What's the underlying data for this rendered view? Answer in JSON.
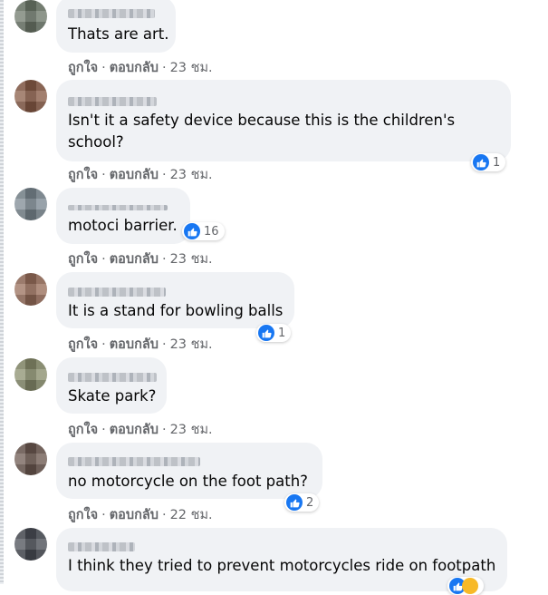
{
  "action_labels": {
    "like": "ถูกใจ",
    "reply": "ตอบกลับ",
    "separator": "·"
  },
  "comments": [
    {
      "text": "Thats are art.",
      "time": "23 ชม.",
      "reaction_count": null
    },
    {
      "text": "Isn't it a safety device because this is the children's\nschool?",
      "time": "23 ชม.",
      "reaction_count": "1"
    },
    {
      "text": "motoci barrier.",
      "time": "23 ชม.",
      "reaction_count": "16"
    },
    {
      "text": "It is a stand for bowling balls",
      "time": "23 ชม.",
      "reaction_count": "1"
    },
    {
      "text": "Skate park?",
      "time": "23 ชม.",
      "reaction_count": null
    },
    {
      "text": "no motorcycle on the foot path?",
      "time": "22 ชม.",
      "reaction_count": "2"
    },
    {
      "text": "I think they tried to prevent motorcycles ride on footpath",
      "time": null,
      "reaction_count": null
    }
  ],
  "icons": {
    "like": "thumbs-up-icon",
    "haha": "laughing-face-icon"
  },
  "colors": {
    "bubble": "#f0f2f5",
    "like_blue": "#1877f2",
    "meta_gray": "#65676b",
    "text": "#050505"
  }
}
